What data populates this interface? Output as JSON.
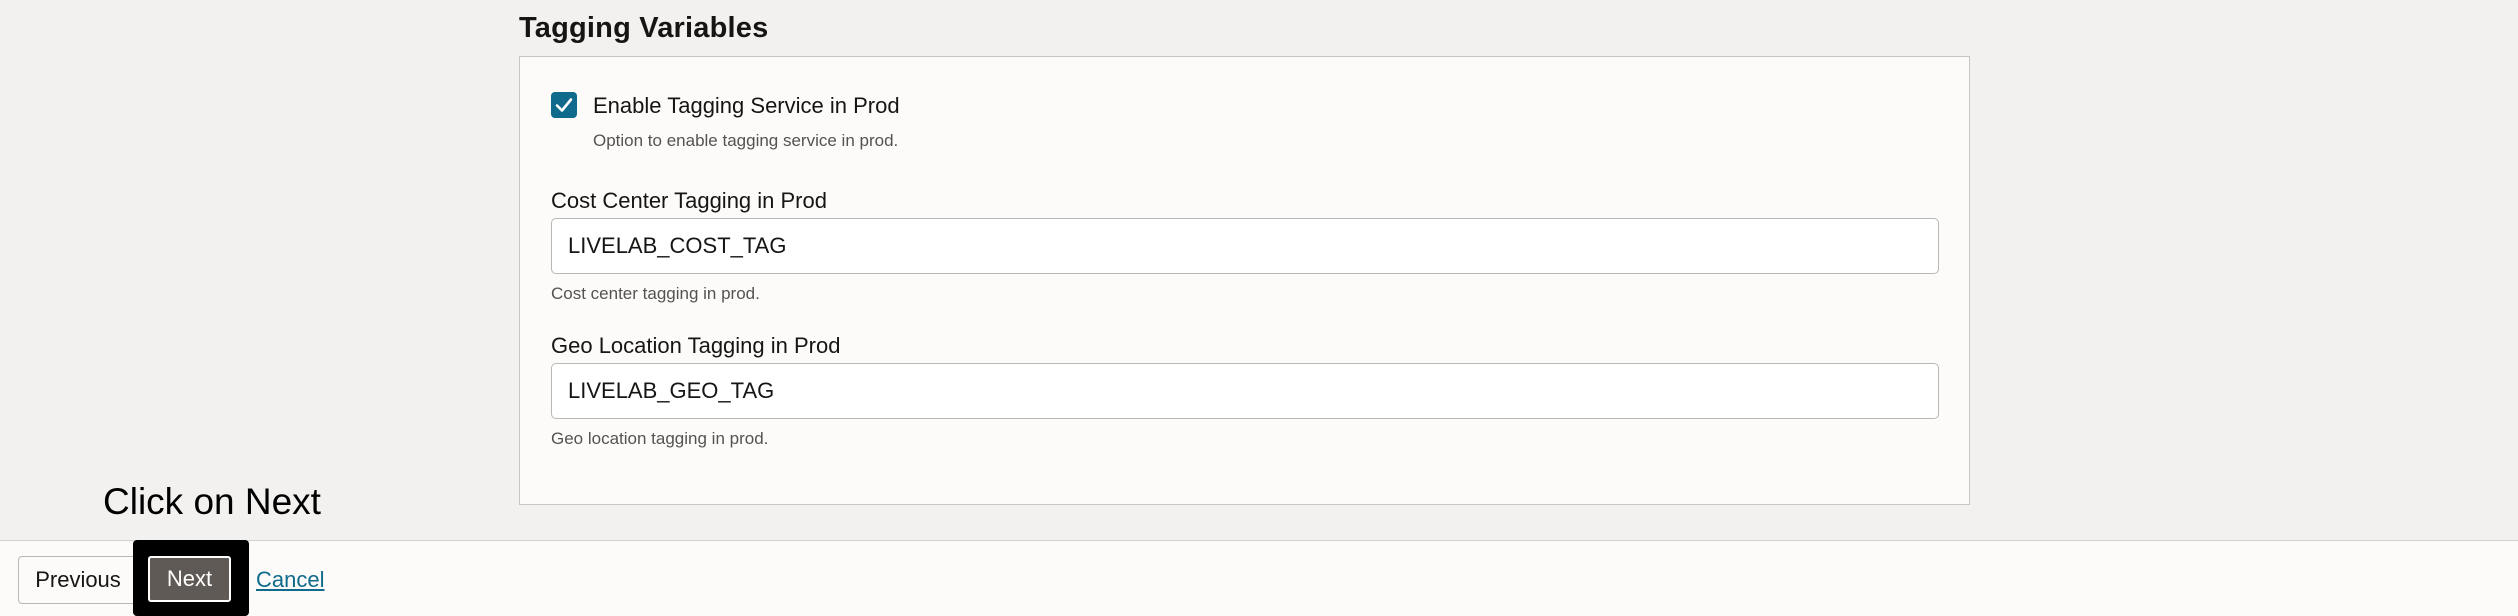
{
  "section": {
    "title": "Tagging Variables"
  },
  "enable_tagging": {
    "checked": true,
    "label": "Enable Tagging Service in Prod",
    "help": "Option to enable tagging service in prod."
  },
  "cost_center": {
    "label": "Cost Center Tagging in Prod",
    "value": "LIVELAB_COST_TAG",
    "help": "Cost center tagging in prod."
  },
  "geo_location": {
    "label": "Geo Location Tagging in Prod",
    "value": "LIVELAB_GEO_TAG",
    "help": "Geo location tagging in prod."
  },
  "footer": {
    "previous_label": "Previous",
    "next_label": "Next",
    "cancel_label": "Cancel"
  },
  "callout": {
    "text": "Click on Next"
  },
  "colors": {
    "accent": "#0f6a8b",
    "next_button": "#5f5a55",
    "highlight": "#000000"
  },
  "icons": {
    "checkbox_check": "check-icon"
  }
}
